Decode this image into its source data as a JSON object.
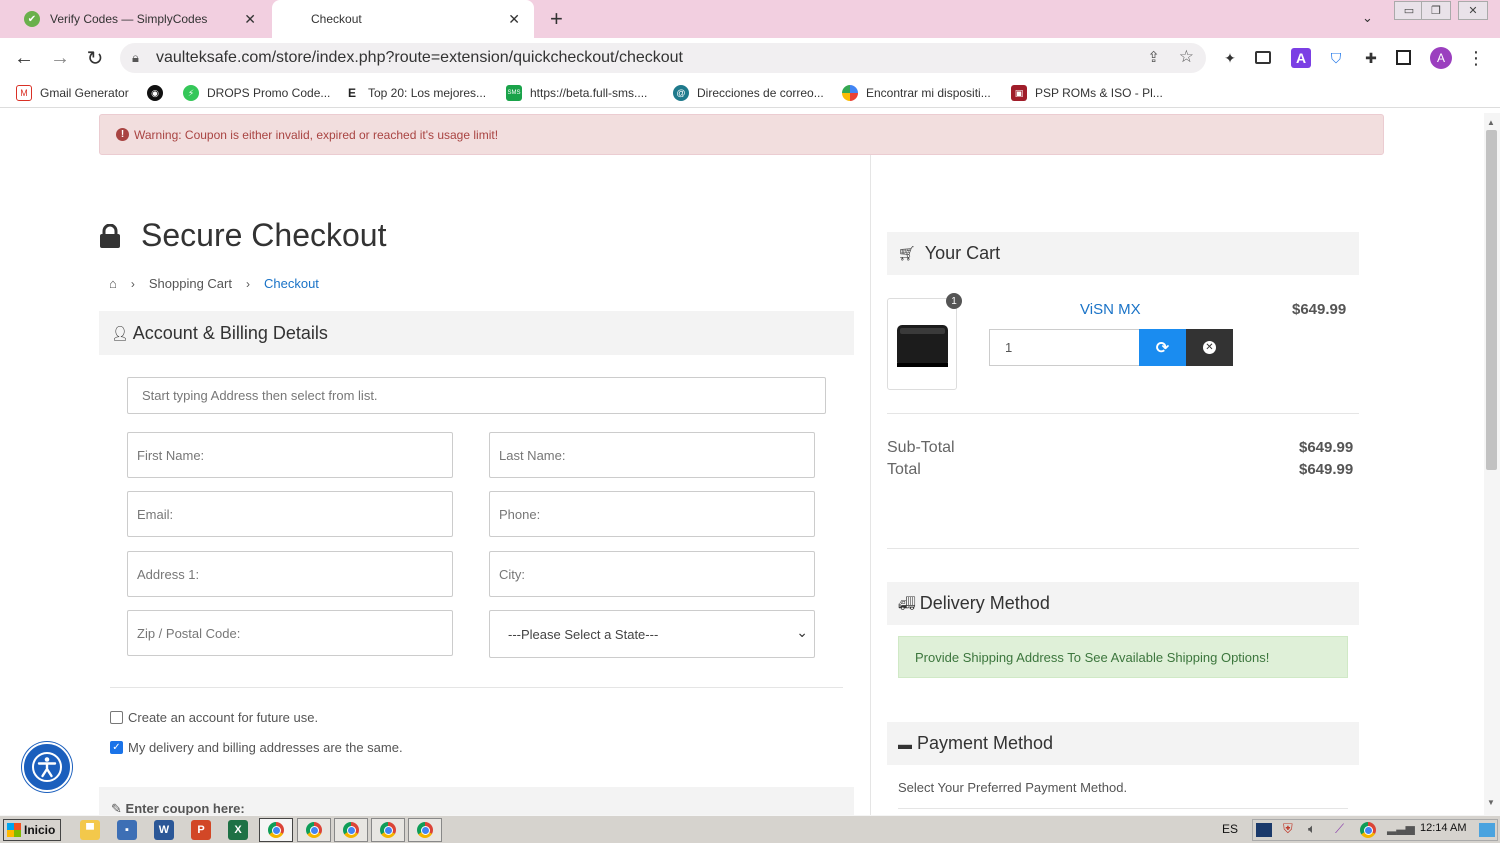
{
  "browser": {
    "tabs": [
      {
        "title": "Verify Codes — SimplyCodes",
        "active": false
      },
      {
        "title": "Checkout",
        "active": true
      }
    ],
    "url": "vaulteksafe.com/store/index.php?route=extension/quickcheckout/checkout",
    "profile_initial": "A",
    "ext_initial": "A"
  },
  "bookmarks": [
    {
      "label": "Gmail Generator",
      "icon": "gmail-generator-icon",
      "color": "#d93025"
    },
    {
      "label": "",
      "icon": "circle-logo-icon",
      "color": "#111111"
    },
    {
      "label": "DROPS Promo Code...",
      "icon": "drops-icon",
      "color": "#35c759"
    },
    {
      "label": "Top 20: Los mejores...",
      "icon": "e-letter-icon",
      "color": "#222222",
      "glyph": "E"
    },
    {
      "label": "https://beta.full-sms....",
      "icon": "sms-icon",
      "color": "#1aa34a",
      "glyph": "SMS"
    },
    {
      "label": "Direcciones de correo...",
      "icon": "mail-globe-icon",
      "color": "#1f7a8c"
    },
    {
      "label": "Encontrar mi dispositi...",
      "icon": "find-device-icon",
      "color": "#4285f4"
    },
    {
      "label": "PSP ROMs & ISO - Pl...",
      "icon": "psp-icon",
      "color": "#a01d2a"
    }
  ],
  "warning": {
    "text": "Warning: Coupon is either invalid, expired or reached it's usage limit!"
  },
  "checkout": {
    "title": "Secure Checkout",
    "breadcrumb": [
      "Shopping Cart",
      "Checkout"
    ],
    "account_section": "Account & Billing Details",
    "address_search": {
      "placeholder": "Start typing Address then select from list."
    },
    "fields": {
      "first_name": "First Name:",
      "last_name": "Last Name:",
      "email": "Email:",
      "phone": "Phone:",
      "address1": "Address 1:",
      "city": "City:",
      "zip": "Zip / Postal Code:",
      "state": "---Please Select a State---"
    },
    "create_account": {
      "label": "Create an account for future use.",
      "checked": false
    },
    "same_address": {
      "label": "My delivery and billing addresses are the same.",
      "checked": true
    },
    "coupon_heading": "Enter coupon here:"
  },
  "cart": {
    "heading": "Your Cart",
    "item": {
      "name": "ViSN MX",
      "price": "$649.99",
      "quantity": "1",
      "badge": "1"
    },
    "subtotal_label": "Sub-Total",
    "subtotal_value": "$649.99",
    "total_label": "Total",
    "total_value": "$649.99"
  },
  "delivery": {
    "heading": "Delivery Method",
    "info": "Provide Shipping Address To See Available Shipping Options!"
  },
  "payment": {
    "heading": "Payment Method",
    "text": "Select Your Preferred Payment Method."
  },
  "taskbar": {
    "start_label": "Inicio",
    "language": "ES",
    "clock": "12:14 AM"
  },
  "colors": {
    "tabstrip": "#f2cfe0",
    "link": "#1a73c7",
    "warning_bg": "#f2dede",
    "success_bg": "#dff0d8",
    "refresh_button": "#1a8cf0"
  }
}
